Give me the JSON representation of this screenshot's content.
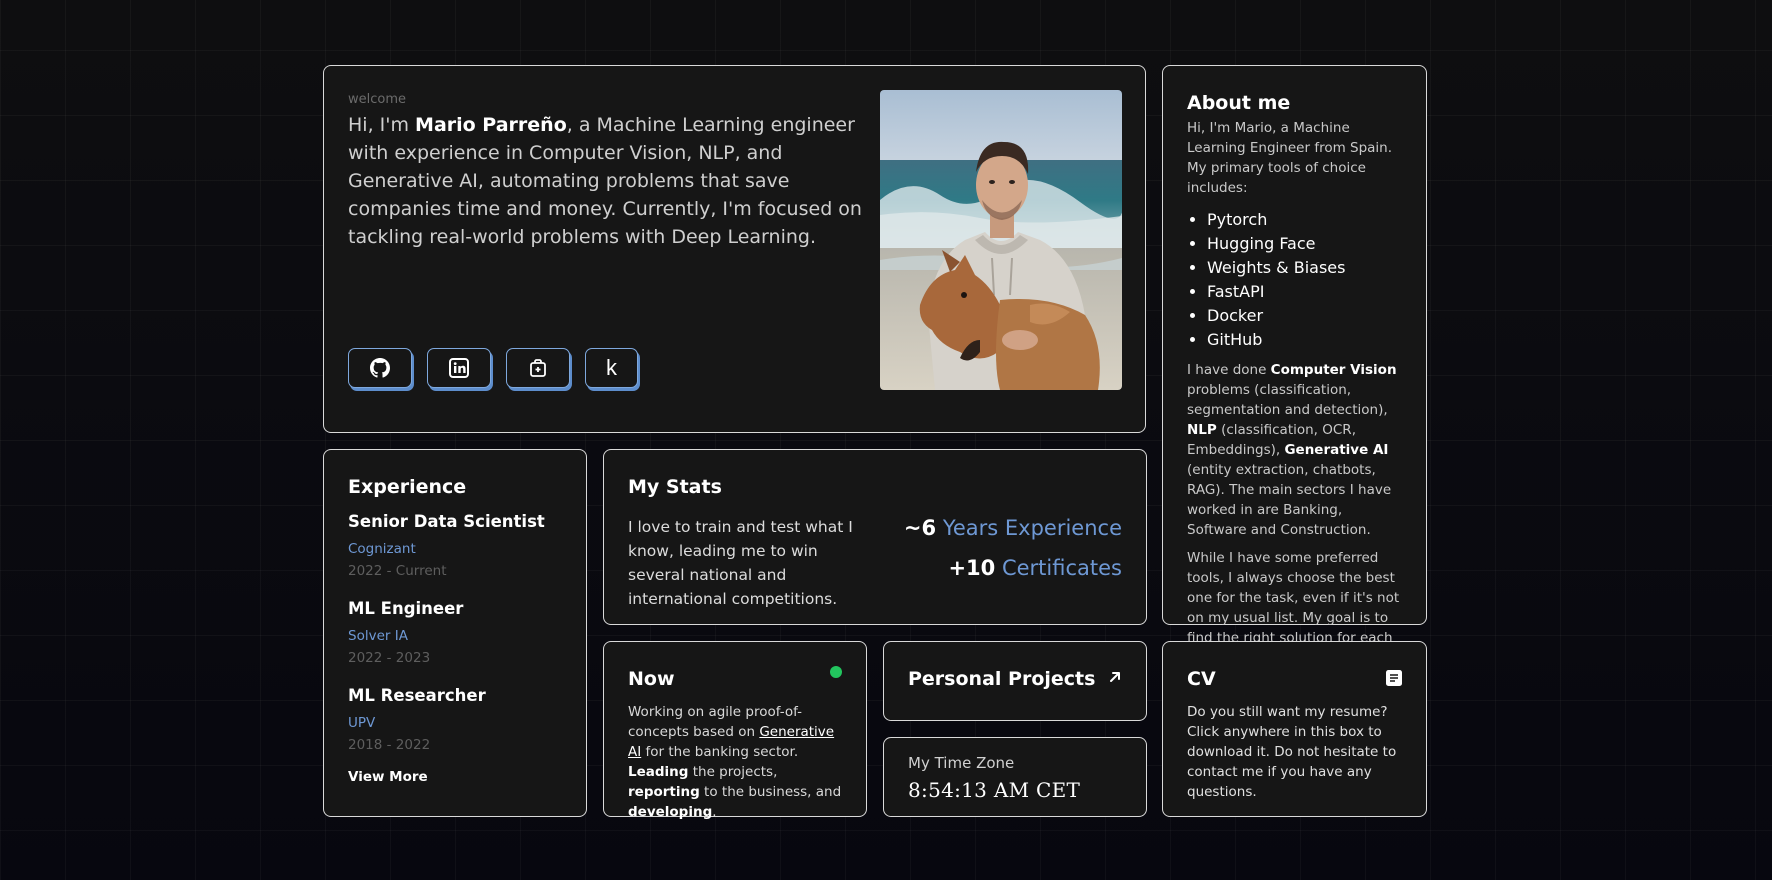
{
  "hero": {
    "welcome": "welcome",
    "intro_prefix": "Hi, I'm ",
    "name": "Mario Parreño",
    "intro_rest": ", a Machine Learning engineer with experience in Computer Vision, NLP, and Generative AI, automating problems that save companies time and money. Currently, I'm focused on tackling real-world problems with Deep Learning.",
    "social_icons": [
      "github-icon",
      "linkedin-icon",
      "briefcase-icon",
      "kaggle-icon"
    ],
    "kaggle_letter": "k"
  },
  "about": {
    "title": "About me",
    "intro": "Hi, I'm Mario, a Machine Learning Engineer from Spain. My primary tools of choice includes:",
    "tools": [
      "Pytorch",
      "Hugging Face",
      "Weights & Biases",
      "FastAPI",
      "Docker",
      "GitHub"
    ],
    "p2_a": "I have done ",
    "p2_b": "Computer Vision",
    "p2_c": " problems (classification, segmentation and detection), ",
    "p2_d": "NLP",
    "p2_e": " (classification, OCR, Embeddings), ",
    "p2_f": "Generative AI",
    "p2_g": " (entity extraction, chatbots, RAG). The main sectors I have worked in are Banking, Software and Construction.",
    "p3": "While I have some preferred tools, I always choose the best one for the task, even if it's not on my usual list. My goal is to find the right solution for each project."
  },
  "experience": {
    "title": "Experience",
    "items": [
      {
        "role": "Senior Data Scientist",
        "company": "Cognizant",
        "dates": "2022 - Current"
      },
      {
        "role": "ML Engineer",
        "company": "Solver IA",
        "dates": "2022 - 2023"
      },
      {
        "role": "ML Researcher",
        "company": "UPV",
        "dates": "2018 - 2022"
      }
    ],
    "view_more": "View More"
  },
  "stats": {
    "title": "My Stats",
    "text": "I love to train and test what I know, leading me to win several national and international competitions.",
    "years_num": "~6",
    "years_label": "Years Experience",
    "certs_num": "+10",
    "certs_label": "Certificates"
  },
  "now": {
    "title": "Now",
    "t1": "Working on agile proof-of-concepts based on ",
    "link": "Generative AI",
    "t2": " for the banking sector. ",
    "b1": "Leading",
    "t3": " the projects, ",
    "b2": "reporting",
    "t4": " to the business, and ",
    "b3": "developing",
    "t5": ".",
    "status_color": "#22c55e"
  },
  "projects": {
    "title": "Personal Projects"
  },
  "timezone": {
    "label": "My Time Zone",
    "time": "8:54:13 AM CET"
  },
  "cv": {
    "title": "CV",
    "text": "Do you still want my resume? Click anywhere in this box to download it. Do not hesitate to contact me if you have any questions."
  },
  "colors": {
    "accent": "#6e98d4",
    "card": "#161616",
    "border": "#d9d9d9"
  }
}
